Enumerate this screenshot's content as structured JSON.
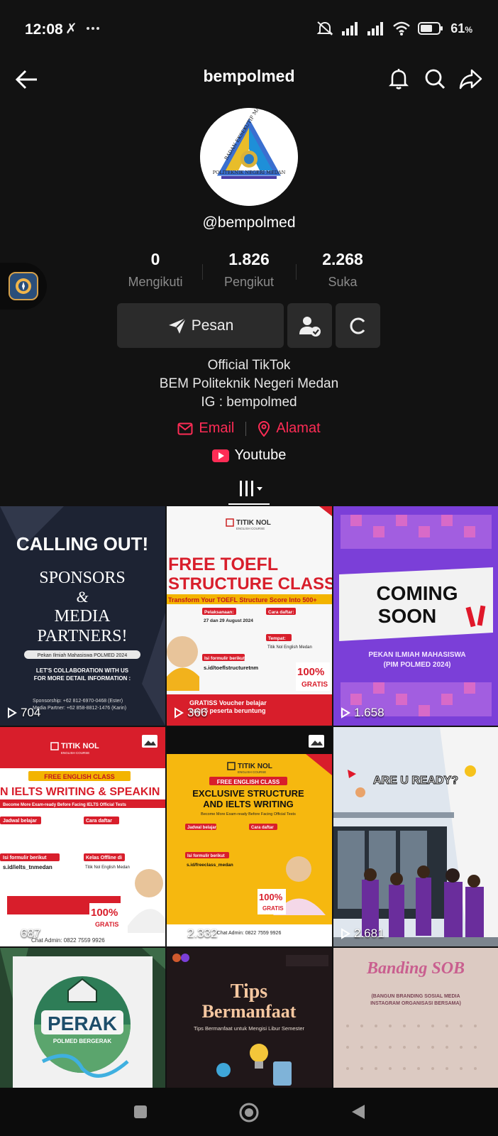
{
  "status_bar": {
    "time": "12:08",
    "battery": "61",
    "battery_unit": "%"
  },
  "header": {
    "title": "bempolmed"
  },
  "profile": {
    "handle": "@bempolmed",
    "logo_text_arc": "BADAN EKSEKUTIF MAHASISWA",
    "logo_text_bottom": "POLITEKNIK NEGERI MEDAN"
  },
  "stats": [
    {
      "value": "0",
      "label": "Mengikuti"
    },
    {
      "value": "1.826",
      "label": "Pengikut"
    },
    {
      "value": "2.268",
      "label": "Suka"
    }
  ],
  "actions": {
    "message_label": "Pesan"
  },
  "bio": {
    "line1": "Official TikTok",
    "line2": "BEM Politeknik Negeri Medan",
    "line3": "IG : bempolmed"
  },
  "links": {
    "email": "Email",
    "address": "Alamat",
    "youtube": "Youtube"
  },
  "colors": {
    "accent": "#fe2c55",
    "background": "#121212",
    "button": "#2b2b2b"
  },
  "videos": [
    {
      "views": "704",
      "line1": "CALLING OUT!",
      "line2": "SPONSORS",
      "line3": "&",
      "line4": "MEDIA",
      "line5": "PARTNERS!",
      "line6": "Pekan Ilmiah Mahasiswa POLMED 2024",
      "line7": "LET'S COLLABORATION WITH US",
      "line8": "FOR MORE DETAIL INFORMATION :",
      "line9": "Sponsorship: +62 812-6970-0468 (Ester)",
      "line10": "Media Partner: +62 858-8812-1476 (Karin)"
    },
    {
      "views": "366",
      "brand": "TITIK NOL",
      "brand_sub": "ENGLISH COURSE",
      "line1": "FREE TOEFL",
      "line2": "STRUCTURE CLASS",
      "line3": "Transform Your TOEFL Structure Score Into 500+",
      "line4": "Pelaksanaan:",
      "line5": "27 dan 29 August 2024",
      "line6": "Cara daftar:",
      "line7": "Tempat:",
      "line8": "Titik Nol English Medan",
      "line9": "Isi formulir berikut:",
      "line10": "s.id/toeflstructuretnm",
      "line11": "GRATISS Voucher belajar",
      "line12": "bagi 5 peserta beruntung",
      "line13": "100%",
      "line14": "GRATIS"
    },
    {
      "views": "1.658",
      "line1": "COMING",
      "line2": "SOON",
      "line3": "PEKAN ILMIAH MAHASISWA",
      "line4": "(PIM POLMED 2024)"
    },
    {
      "views": "687",
      "brand": "TITIK NOL",
      "brand_sub": "ENGLISH COURSE",
      "line1": "FREE ENGLISH CLASS",
      "line2": "N IELTS WRITING & SPEAKIN",
      "line3": "Become More Exam-ready Before Facing IELTS Official Tests",
      "line4": "Jadwal belajar",
      "line5": "Cara daftar",
      "line6": "Isi formulir berikut",
      "line7": "s.id/ielts_tnmedan",
      "line8": "Kelas Offline di",
      "line9": "Titik Nol English Medan",
      "line10": "100%",
      "line11": "GRATIS",
      "line12": "Chat Admin: 0822 7559 9926"
    },
    {
      "views": "2.332",
      "brand": "TITIK NOL",
      "brand_sub": "ENGLISH COURSE",
      "line1": "FREE ENGLISH CLASS",
      "line2": "EXCLUSIVE STRUCTURE",
      "line3": "AND IELTS WRITING",
      "line4": "Become More Exam-ready Before Facing Official Tests",
      "line5": "Jadwal belajar",
      "line6": "Cara daftar",
      "line7": "Isi formulir berikut",
      "line8": "s.id/freeclass_medan",
      "line9": "100%",
      "line10": "GRATIS",
      "line11": "Chat Admin: 0822 7559 9926"
    },
    {
      "views": "2.681",
      "line1": "ARE U READY?"
    },
    {
      "line1": "PERAK",
      "line2": "POLMED BERGERAK"
    },
    {
      "line1": "Tips",
      "line2": "Bermanfaat",
      "line3": "Tips Bermanfaat untuk Mengisi Libur Semester"
    },
    {
      "line1": "Banding SOB",
      "line2": "(BANGUN BRANDING SOSIAL MEDIA",
      "line3": "INSTAGRAM ORGANISASI BERSAMA)"
    }
  ]
}
